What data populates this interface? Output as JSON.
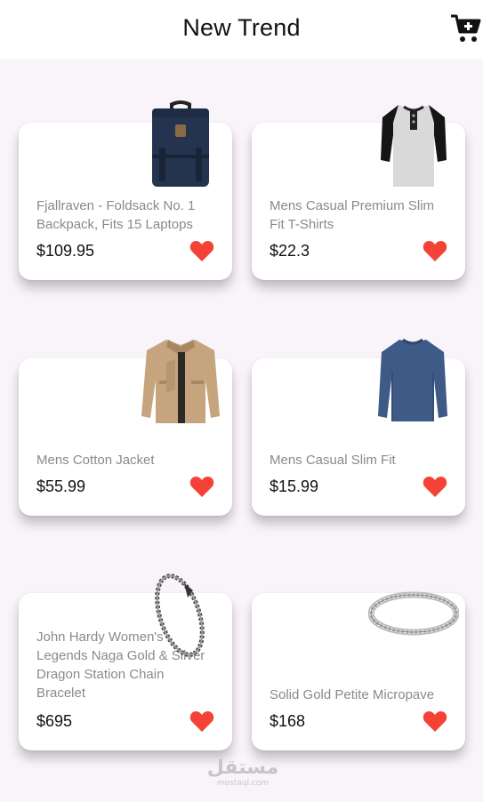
{
  "appbar": {
    "title": "New Trend",
    "cart_icon": "cart-plus-icon"
  },
  "products": [
    {
      "name": "Fjallraven - Foldsack No. 1 Backpack, Fits 15 Laptops",
      "price": "$109.95",
      "image": "backpack",
      "favorite": true
    },
    {
      "name": "Mens Casual Premium Slim Fit T-Shirts",
      "price": "$22.3",
      "image": "henley-shirt",
      "favorite": true
    },
    {
      "name": "Mens Cotton Jacket",
      "price": "$55.99",
      "image": "cotton-jacket",
      "favorite": true
    },
    {
      "name": "Mens Casual Slim Fit",
      "price": "$15.99",
      "image": "slim-fit-shirt",
      "favorite": true
    },
    {
      "name": "John Hardy Women's Legends Naga Gold & Silver Dragon Station Chain Bracelet",
      "price": "$695",
      "image": "dragon-bracelet",
      "favorite": true
    },
    {
      "name": "Solid Gold Petite Micropave",
      "price": "$168",
      "image": "micropave-ring",
      "favorite": true
    }
  ],
  "colors": {
    "favorite": "#f44336",
    "background": "#f9f4fa",
    "card": "#ffffff"
  },
  "watermark": {
    "main": "مستقل",
    "sub": "mostaql.com"
  }
}
